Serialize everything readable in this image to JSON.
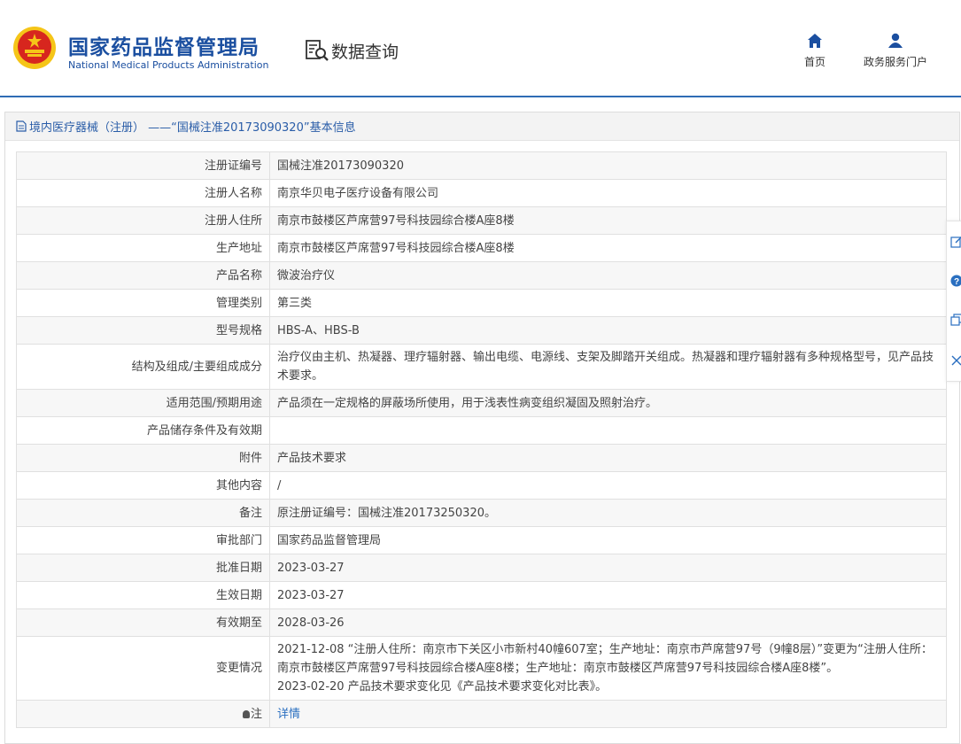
{
  "header": {
    "org_name_cn": "国家药品监督管理局",
    "org_name_en": "National Medical Products Administration",
    "query_label": "数据查询",
    "nav": [
      {
        "label": "首页",
        "icon": "home-icon"
      },
      {
        "label": "政务服务门户",
        "icon": "user-icon"
      }
    ]
  },
  "panel": {
    "title": "境内医疗器械（注册） ——“国械注准20173090320”基本信息"
  },
  "fields": [
    {
      "label": "注册证编号",
      "value": "国械注准20173090320"
    },
    {
      "label": "注册人名称",
      "value": "南京华贝电子医疗设备有限公司"
    },
    {
      "label": "注册人住所",
      "value": "南京市鼓楼区芦席营97号科技园综合楼A座8楼"
    },
    {
      "label": "生产地址",
      "value": "南京市鼓楼区芦席营97号科技园综合楼A座8楼"
    },
    {
      "label": "产品名称",
      "value": "微波治疗仪"
    },
    {
      "label": "管理类别",
      "value": "第三类"
    },
    {
      "label": "型号规格",
      "value": "HBS-A、HBS-B"
    },
    {
      "label": "结构及组成/主要组成成分",
      "value": "治疗仪由主机、热凝器、理疗辐射器、输出电缆、电源线、支架及脚踏开关组成。热凝器和理疗辐射器有多种规格型号，见产品技术要求。"
    },
    {
      "label": "适用范围/预期用途",
      "value": "产品须在一定规格的屏蔽场所使用，用于浅表性病变组织凝固及照射治疗。"
    },
    {
      "label": "产品储存条件及有效期",
      "value": ""
    },
    {
      "label": "附件",
      "value": "产品技术要求"
    },
    {
      "label": "其他内容",
      "value": "/"
    },
    {
      "label": "备注",
      "value": "原注册证编号：国械注准20173250320。"
    },
    {
      "label": "审批部门",
      "value": "国家药品监督管理局"
    },
    {
      "label": "批准日期",
      "value": "2023-03-27"
    },
    {
      "label": "生效日期",
      "value": "2023-03-27"
    },
    {
      "label": "有效期至",
      "value": "2028-03-26"
    }
  ],
  "changes": {
    "label": "变更情况",
    "lines": [
      "2021-12-08 “注册人住所：南京市下关区小市新村40幢607室；生产地址：南京市芦席营97号（9幢8层）”变更为“注册人住所：南京市鼓楼区芦席营97号科技园综合楼A座8楼；生产地址：南京市鼓楼区芦席营97号科技园综合楼A座8楼”。",
      "2023-02-20 产品技术要求变化见《产品技术要求变化对比表》。"
    ]
  },
  "note": {
    "label": "注",
    "link_text": "详情"
  },
  "side_tools": [
    "edit-icon",
    "help-icon",
    "copy-icon",
    "close-icon"
  ],
  "colors": {
    "brand_blue": "#1b4fa0",
    "link_blue": "#2a6fc0",
    "emblem_red": "#d7261e",
    "emblem_gold": "#f5c518"
  }
}
